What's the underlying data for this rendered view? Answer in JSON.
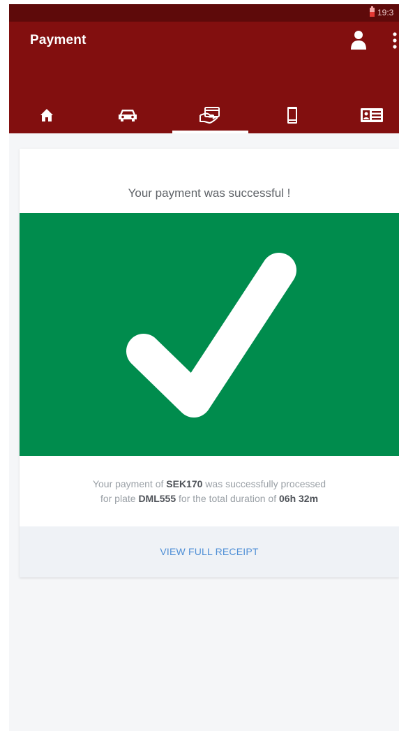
{
  "status_bar": {
    "time": "19:3",
    "icons": [
      "battery-icon"
    ]
  },
  "app_bar": {
    "title": "Payment",
    "actions": [
      "profile-icon",
      "overflow-menu-icon"
    ]
  },
  "tabs": [
    {
      "icon": "home-icon",
      "selected": false
    },
    {
      "icon": "car-icon",
      "selected": false
    },
    {
      "icon": "payment-hand-card-icon",
      "selected": true
    },
    {
      "icon": "phone-icon",
      "selected": false
    },
    {
      "icon": "id-card-icon",
      "selected": false
    }
  ],
  "card": {
    "heading": "Your payment was successful !",
    "success_icon": "checkmark-icon",
    "message": {
      "part1": "Your payment of ",
      "amount": "SEK170",
      "part2": " was successfully processed",
      "part3": "for plate ",
      "plate": "DML555",
      "part4": " for the total duration of ",
      "duration": "06h 32m"
    },
    "receipt_link": "VIEW FULL RECEIPT"
  },
  "colors": {
    "app_bar": "#820f0f",
    "status_bar": "#5e0a0a",
    "success": "#008c4d",
    "link": "#4f8fd6"
  }
}
